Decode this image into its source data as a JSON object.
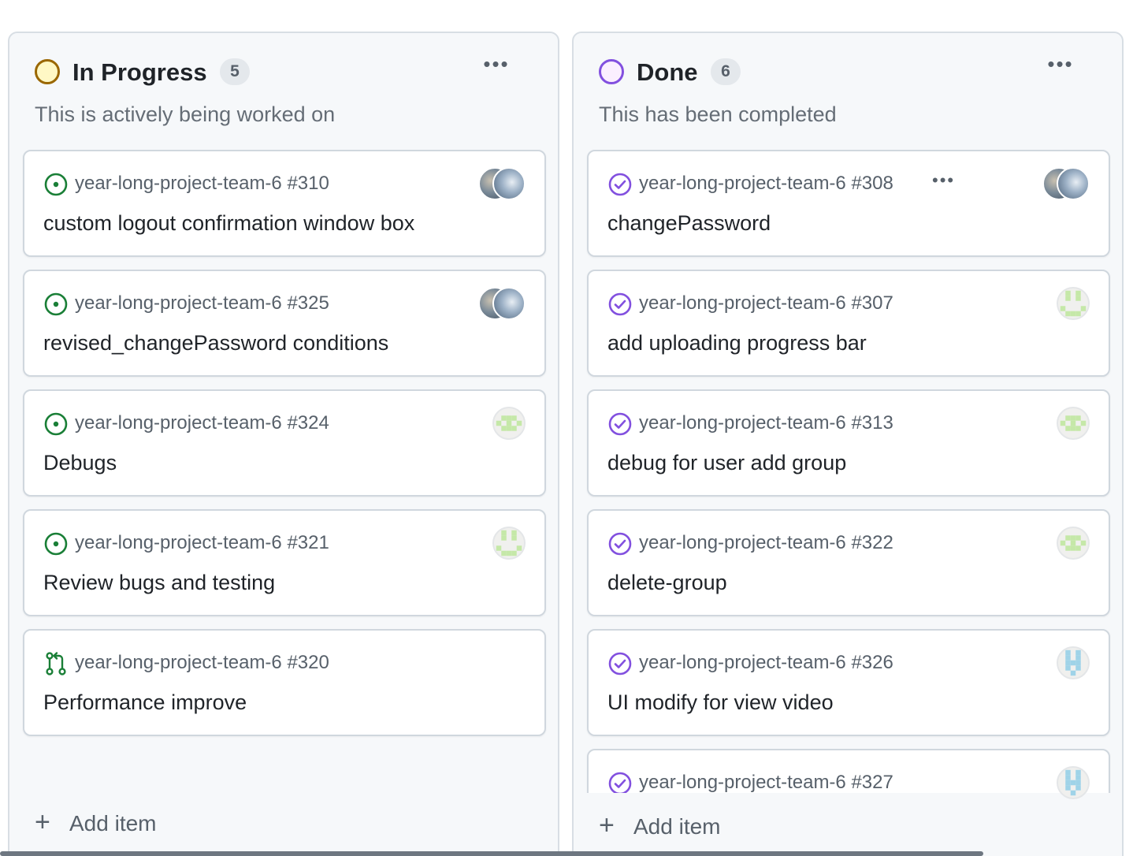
{
  "columns": [
    {
      "title": "In Progress",
      "count": "5",
      "description": "This is actively being worked on",
      "status_color": "#9a6700",
      "status_fill": "#fff8c5",
      "add_label": "Add item",
      "cards": [
        {
          "meta": "year-long-project-team-6 #310",
          "title": "custom logout confirmation window box",
          "icon": "issue-open-icon",
          "avatars": [
            "photo",
            "photo"
          ]
        },
        {
          "meta": "year-long-project-team-6 #325",
          "title": "revised_changePassword conditions",
          "icon": "issue-open-icon",
          "avatars": [
            "photo",
            "photo"
          ]
        },
        {
          "meta": "year-long-project-team-6 #324",
          "title": "Debugs",
          "icon": "issue-open-icon",
          "avatars": [
            "identicon-green-grid"
          ]
        },
        {
          "meta": "year-long-project-team-6 #321",
          "title": "Review bugs and testing",
          "icon": "issue-open-icon",
          "avatars": [
            "identicon-green-face"
          ]
        },
        {
          "meta": "year-long-project-team-6 #320",
          "title": "Performance improve",
          "icon": "pull-request-icon",
          "avatars": []
        }
      ]
    },
    {
      "title": "Done",
      "count": "6",
      "description": "This has been completed",
      "status_color": "#8250df",
      "status_fill": "#fbefff",
      "add_label": "Add item",
      "cards": [
        {
          "meta": "year-long-project-team-6 #308",
          "title": "changePassword",
          "icon": "issue-closed-icon",
          "avatars": [
            "photo",
            "photo"
          ],
          "more": "•••"
        },
        {
          "meta": "year-long-project-team-6 #307",
          "title": "add uploading progress bar",
          "icon": "issue-closed-icon",
          "avatars": [
            "identicon-green-face"
          ]
        },
        {
          "meta": "year-long-project-team-6 #313",
          "title": "debug for user add group",
          "icon": "issue-closed-icon",
          "avatars": [
            "identicon-green-grid"
          ]
        },
        {
          "meta": "year-long-project-team-6 #322",
          "title": "delete-group",
          "icon": "issue-closed-icon",
          "avatars": [
            "identicon-green-grid"
          ]
        },
        {
          "meta": "year-long-project-team-6 #326",
          "title": "UI modify for view video",
          "icon": "issue-closed-icon",
          "avatars": [
            "identicon-blue-h"
          ]
        },
        {
          "meta": "year-long-project-team-6 #327",
          "title": "",
          "icon": "issue-closed-icon",
          "avatars": [
            "identicon-blue-h"
          ]
        }
      ]
    }
  ],
  "colors": {
    "open_green": "#1a7f37",
    "closed_purple": "#8250df",
    "identicon_green": "#c5e8a8",
    "identicon_blue": "#9fd3e8"
  },
  "column_more_label": "•••"
}
